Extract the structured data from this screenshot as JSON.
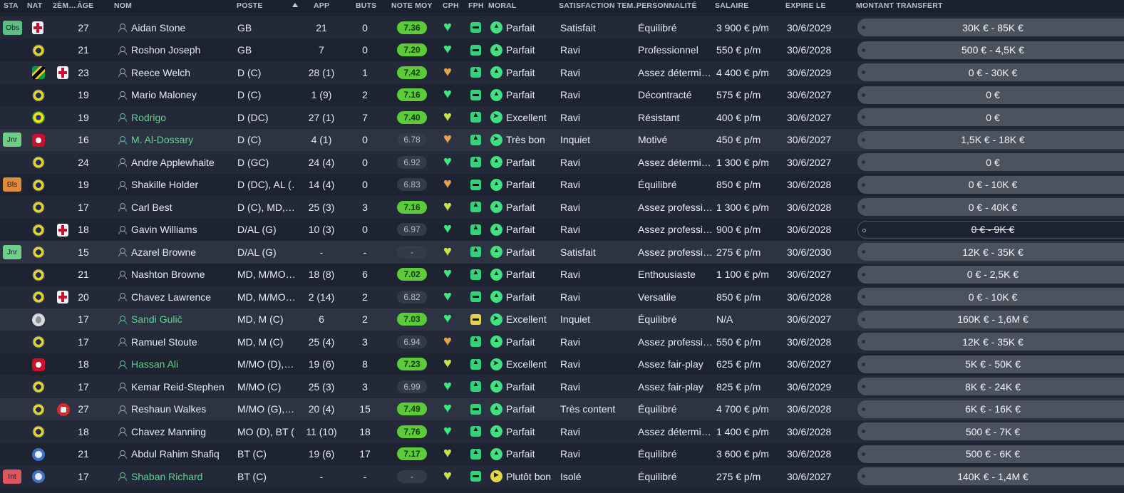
{
  "columns": {
    "sta": "STA",
    "nat": "NAT",
    "nat2": "2ÈM…",
    "age": "ÂGE",
    "name": "NOM",
    "poste": "POSTE",
    "app": "APP",
    "buts": "BUTS",
    "note": "NOTE MOY",
    "cph": "CPH",
    "fph": "FPH",
    "moral": "MORAL",
    "satisfaction": "SATISFACTION TEM…",
    "personnalite": "PERSONNALITÉ",
    "salaire": "SALAIRE",
    "expire": "EXPIRE LE",
    "transfert": "MONTANT TRANSFERT"
  },
  "colors": {
    "rating_green": "#5bcb3a",
    "name_green": "#62d28e",
    "obs": "#5cbf82",
    "jnr": "#6fcf89",
    "bls": "#e08a3c",
    "int": "#e0565e"
  },
  "players": [
    {
      "sta": "Obs",
      "nat": "england-flag",
      "nat2": "",
      "age": "27",
      "name": "Aidan Stone",
      "green": false,
      "poste": "GB",
      "app": "21",
      "buts": "0",
      "note": "7.36",
      "note_green": true,
      "cph": "green",
      "fph": "minus",
      "moral_icon": "up-arrow",
      "moral": "Parfait",
      "sat": "Satisfait",
      "pers": "Équilibré",
      "sal": "3 900 € p/m",
      "exp": "30/6/2029",
      "transfert": "30K € - 85K €"
    },
    {
      "sta": "",
      "nat": "ball-flag",
      "nat2": "",
      "age": "21",
      "name": "Roshon Joseph",
      "green": false,
      "poste": "GB",
      "app": "7",
      "buts": "0",
      "note": "7.20",
      "note_green": true,
      "cph": "green",
      "fph": "minus",
      "moral_icon": "up-arrow",
      "moral": "Parfait",
      "sat": "Ravi",
      "pers": "Professionnel",
      "sal": "550 € p/m",
      "exp": "30/6/2028",
      "transfert": "500 € - 4,5K €"
    },
    {
      "sta": "",
      "nat": "jamaica-flag",
      "nat2": "england-flag",
      "age": "23",
      "name": "Reece Welch",
      "green": false,
      "poste": "D (C)",
      "app": "28 (1)",
      "buts": "1",
      "note": "7.42",
      "note_green": true,
      "cph": "orange",
      "fph": "thumb",
      "moral_icon": "up-arrow",
      "moral": "Parfait",
      "sat": "Ravi",
      "pers": "Assez détermi…",
      "sal": "4 400 € p/m",
      "exp": "30/6/2029",
      "transfert": "0 € - 30K €"
    },
    {
      "sta": "",
      "nat": "ball-flag",
      "nat2": "",
      "age": "19",
      "name": "Mario Maloney",
      "green": false,
      "poste": "D (C)",
      "app": "1 (9)",
      "buts": "2",
      "note": "7.16",
      "note_green": true,
      "cph": "green",
      "fph": "minus",
      "moral_icon": "up-arrow",
      "moral": "Parfait",
      "sat": "Ravi",
      "pers": "Décontracté",
      "sal": "575 € p/m",
      "exp": "30/6/2027",
      "transfert": "0 €"
    },
    {
      "sta": "",
      "nat": "brazil-flag",
      "nat2": "",
      "age": "19",
      "name": "Rodrigo",
      "green": true,
      "poste": "D (DC)",
      "app": "27 (1)",
      "buts": "7",
      "note": "7.40",
      "note_green": true,
      "cph": "lime",
      "fph": "thumb",
      "moral_icon": "plane",
      "moral": "Excellent",
      "sat": "Ravi",
      "pers": "Résistant",
      "sal": "400 € p/m",
      "exp": "30/6/2027",
      "transfert": "0 €"
    },
    {
      "sta": "Jnr",
      "nat": "red-flag",
      "nat2": "",
      "age": "16",
      "name": "M. Al-Dossary",
      "green": true,
      "poste": "D (C)",
      "app": "4 (1)",
      "buts": "0",
      "note": "6.78",
      "note_green": false,
      "cph": "orange",
      "fph": "thumb",
      "moral_icon": "plane",
      "moral": "Très bon",
      "sat": "Inquiet",
      "pers": "Motivé",
      "sal": "450 € p/m",
      "exp": "30/6/2027",
      "transfert": "1,5K € - 18K €"
    },
    {
      "sta": "",
      "nat": "ball-flag",
      "nat2": "",
      "age": "24",
      "name": "Andre Applewhaite",
      "green": false,
      "poste": "D (GC)",
      "app": "24 (4)",
      "buts": "0",
      "note": "6.92",
      "note_green": false,
      "cph": "green",
      "fph": "thumb",
      "moral_icon": "up-arrow",
      "moral": "Parfait",
      "sat": "Ravi",
      "pers": "Assez détermi…",
      "sal": "1 300 € p/m",
      "exp": "30/6/2027",
      "transfert": "0 €"
    },
    {
      "sta": "Bls",
      "nat": "ball-flag",
      "nat2": "",
      "age": "19",
      "name": "Shakille Holder",
      "green": false,
      "poste": "D (DC), AL (…",
      "app": "14 (4)",
      "buts": "0",
      "note": "6.83",
      "note_green": false,
      "cph": "orange",
      "fph": "minus",
      "moral_icon": "up-arrow",
      "moral": "Parfait",
      "sat": "Ravi",
      "pers": "Équilibré",
      "sal": "850 € p/m",
      "exp": "30/6/2028",
      "transfert": "0 € - 10K €"
    },
    {
      "sta": "",
      "nat": "ball-flag",
      "nat2": "",
      "age": "17",
      "name": "Carl Best",
      "green": false,
      "poste": "D (C), MD,…",
      "app": "25 (3)",
      "buts": "3",
      "note": "7.16",
      "note_green": true,
      "cph": "lime",
      "fph": "thumb",
      "moral_icon": "up-arrow",
      "moral": "Parfait",
      "sat": "Ravi",
      "pers": "Assez professi…",
      "sal": "1 300 € p/m",
      "exp": "30/6/2028",
      "transfert": "0 € - 40K €"
    },
    {
      "sta": "",
      "nat": "ball-flag",
      "nat2": "england-flag",
      "age": "18",
      "name": "Gavin Williams",
      "green": false,
      "poste": "D/AL (G)",
      "app": "10 (3)",
      "buts": "0",
      "note": "6.97",
      "note_green": false,
      "cph": "green",
      "fph": "thumb",
      "moral_icon": "up-arrow",
      "moral": "Parfait",
      "sat": "Ravi",
      "pers": "Assez professi…",
      "sal": "900 € p/m",
      "exp": "30/6/2028",
      "transfert": "0 € - 9K €",
      "transfert_strike": true
    },
    {
      "sta": "Jnr",
      "nat": "ball-flag",
      "nat2": "",
      "age": "15",
      "name": "Azarel Browne",
      "green": false,
      "poste": "D/AL (G)",
      "app": "-",
      "buts": "-",
      "note": "-",
      "note_green": false,
      "cph": "lime",
      "fph": "thumb",
      "moral_icon": "up-arrow",
      "moral": "Parfait",
      "sat": "Satisfait",
      "pers": "Assez professi…",
      "sal": "275 € p/m",
      "exp": "30/6/2030",
      "transfert": "12K € - 35K €"
    },
    {
      "sta": "",
      "nat": "ball-flag",
      "nat2": "",
      "age": "21",
      "name": "Nashton Browne",
      "green": false,
      "poste": "MD, M/MO…",
      "app": "18 (8)",
      "buts": "6",
      "note": "7.02",
      "note_green": true,
      "cph": "green",
      "fph": "thumb",
      "moral_icon": "up-arrow",
      "moral": "Parfait",
      "sat": "Ravi",
      "pers": "Enthousiaste",
      "sal": "1 100 € p/m",
      "exp": "30/6/2027",
      "transfert": "0 € - 2,5K €"
    },
    {
      "sta": "",
      "nat": "ball-flag",
      "nat2": "england-flag",
      "age": "20",
      "name": "Chavez Lawrence",
      "green": false,
      "poste": "MD, M/MO…",
      "app": "2 (14)",
      "buts": "2",
      "note": "6.82",
      "note_green": false,
      "cph": "green",
      "fph": "minus",
      "moral_icon": "up-arrow",
      "moral": "Parfait",
      "sat": "Ravi",
      "pers": "Versatile",
      "sal": "850 € p/m",
      "exp": "30/6/2028",
      "transfert": "0 € - 10K €"
    },
    {
      "sta": "",
      "nat": "white-flag",
      "nat2": "",
      "age": "17",
      "name": "Sandi Gulič",
      "green": true,
      "poste": "MD, M (C)",
      "app": "6",
      "buts": "2",
      "note": "7.03",
      "note_green": true,
      "cph": "green",
      "fph": "yellow-minus",
      "moral_icon": "plane",
      "moral": "Excellent",
      "sat": "Inquiet",
      "pers": "Équilibré",
      "sal": "N/A",
      "exp": "30/6/2027",
      "transfert": "160K € - 1,6M €"
    },
    {
      "sta": "",
      "nat": "ball-flag",
      "nat2": "",
      "age": "17",
      "name": "Ramuel Stoute",
      "green": false,
      "poste": "MD, M (C)",
      "app": "25 (4)",
      "buts": "3",
      "note": "6.94",
      "note_green": false,
      "cph": "orange",
      "fph": "thumb",
      "moral_icon": "up-arrow",
      "moral": "Parfait",
      "sat": "Ravi",
      "pers": "Assez professi…",
      "sal": "550 € p/m",
      "exp": "30/6/2028",
      "transfert": "12K € - 35K €"
    },
    {
      "sta": "",
      "nat": "red-flag",
      "nat2": "",
      "age": "18",
      "name": "Hassan Ali",
      "green": true,
      "poste": "M/MO (D),…",
      "app": "19 (6)",
      "buts": "8",
      "note": "7.23",
      "note_green": true,
      "cph": "lime",
      "fph": "thumb",
      "moral_icon": "plane",
      "moral": "Excellent",
      "sat": "Ravi",
      "pers": "Assez fair-play",
      "sal": "625 € p/m",
      "exp": "30/6/2027",
      "transfert": "5K € - 50K €"
    },
    {
      "sta": "",
      "nat": "ball-flag",
      "nat2": "",
      "age": "17",
      "name": "Kemar Reid-Stephen",
      "green": false,
      "poste": "M/MO (C)",
      "app": "25 (3)",
      "buts": "3",
      "note": "6.99",
      "note_green": false,
      "cph": "green",
      "fph": "thumb",
      "moral_icon": "up-arrow",
      "moral": "Parfait",
      "sat": "Ravi",
      "pers": "Assez fair-play",
      "sal": "825 € p/m",
      "exp": "30/6/2029",
      "transfert": "8K € - 24K €"
    },
    {
      "sta": "",
      "nat": "ball-flag",
      "nat2": "canada-flag",
      "age": "27",
      "name": "Reshaun Walkes",
      "green": false,
      "poste": "M/MO (G),…",
      "app": "20 (4)",
      "buts": "15",
      "note": "7.49",
      "note_green": true,
      "cph": "green",
      "fph": "minus",
      "moral_icon": "up-arrow",
      "moral": "Parfait",
      "sat": "Très content",
      "pers": "Équilibré",
      "sal": "4 700 € p/m",
      "exp": "30/6/2028",
      "transfert": "6K € - 16K €"
    },
    {
      "sta": "",
      "nat": "ball-flag",
      "nat2": "",
      "age": "18",
      "name": "Chavez Manning",
      "green": false,
      "poste": "MO (D), BT (…",
      "app": "11 (10)",
      "buts": "18",
      "note": "7.76",
      "note_green": true,
      "cph": "green",
      "fph": "thumb",
      "moral_icon": "up-arrow",
      "moral": "Parfait",
      "sat": "Ravi",
      "pers": "Assez détermi…",
      "sal": "1 400 € p/m",
      "exp": "30/6/2028",
      "transfert": "500 € - 7K €"
    },
    {
      "sta": "",
      "nat": "blue-flag",
      "nat2": "",
      "age": "21",
      "name": "Abdul Rahim Shafiq",
      "green": false,
      "poste": "BT (C)",
      "app": "19 (6)",
      "buts": "17",
      "note": "7.17",
      "note_green": true,
      "cph": "lime",
      "fph": "thumb",
      "moral_icon": "up-arrow",
      "moral": "Parfait",
      "sat": "Ravi",
      "pers": "Équilibré",
      "sal": "3 600 € p/m",
      "exp": "30/6/2028",
      "transfert": "500 € - 6K €"
    },
    {
      "sta": "Int",
      "nat": "blue-flag",
      "nat2": "",
      "age": "17",
      "name": "Shaban Richard",
      "green": true,
      "poste": "BT (C)",
      "app": "-",
      "buts": "-",
      "note": "-",
      "note_green": false,
      "cph": "lime",
      "fph": "minus",
      "moral_icon": "play",
      "moral": "Plutôt bon",
      "sat": "Isolé",
      "pers": "Équilibré",
      "sal": "275 € p/m",
      "exp": "30/6/2027",
      "transfert": "140K € - 1,4M €"
    }
  ]
}
